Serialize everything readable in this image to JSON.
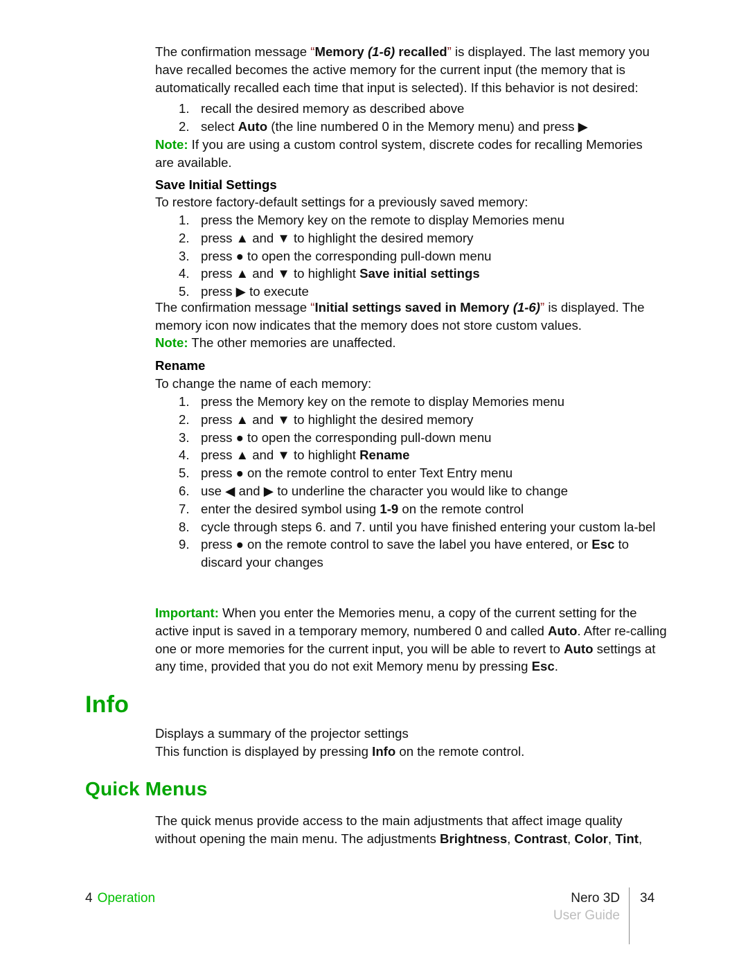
{
  "colors": {
    "accent_green": "#00a500",
    "footer_green": "#00c000",
    "quote_marks": "#8d2020",
    "body_text": "#111111",
    "muted_gray": "#bdbdbd"
  },
  "glyphs": {
    "up": "▲",
    "down": "▼",
    "dot": "●",
    "right": "▶",
    "left": "◀",
    "ldquo": "“",
    "rdquo": "”"
  },
  "blocks": {
    "para_recalled": {
      "lead": "The confirmation message ",
      "quoted_bold_1": "Memory ",
      "quoted_bolditalic": "(1-6)",
      "quoted_bold_2": " recalled",
      "tail": " is displayed. The last memory you have recalled becomes the active memory for the current input (the memory that is automatically recalled each time that input is selected). If this behavior is not desired:"
    },
    "list_recall": [
      {
        "num": "1.",
        "text": "recall the desired memory as described above"
      },
      {
        "num": "2.",
        "pre": "select ",
        "bold": "Auto",
        "post": " (the line numbered 0 in the Memory menu) and press ▶"
      }
    ],
    "note_custom_control": {
      "label": "Note:",
      "text": " If you are using a custom control system, discrete codes for recalling Memories are available."
    },
    "heading_save_initial": "Save Initial Settings",
    "para_restore": "To restore factory-default settings for a previously saved memory:",
    "list_save": [
      {
        "num": "1.",
        "text": "press the Memory key on the remote to display Memories menu"
      },
      {
        "num": "2.",
        "text": "press ▲ and ▼ to highlight the desired memory"
      },
      {
        "num": "3.",
        "text": "press ● to open the corresponding pull-down menu"
      },
      {
        "num": "4.",
        "pre": "press ▲ and ▼ to highlight ",
        "bold": "Save initial settings",
        "post": ""
      },
      {
        "num": "5.",
        "text": "press ▶ to execute"
      }
    ],
    "para_initial_saved": {
      "lead": "The confirmation message ",
      "quoted_bold_1": "Initial settings saved in Memory ",
      "quoted_bolditalic": "(1-6)",
      "quoted_bold_2": "",
      "tail": " is displayed. The memory icon now indicates that the memory does not store custom values."
    },
    "note_other_memories": {
      "label": "Note:",
      "text": " The other memories are unaffected."
    },
    "heading_rename": "Rename",
    "para_change_name": "To change the name of each memory:",
    "list_rename": [
      {
        "num": "1.",
        "text": "press the Memory key on the remote to display Memories menu"
      },
      {
        "num": "2.",
        "text": "press ▲ and ▼ to highlight the desired memory"
      },
      {
        "num": "3.",
        "text": "press ● to open the corresponding pull-down menu"
      },
      {
        "num": "4.",
        "pre": "press ▲ and ▼ to highlight ",
        "bold": "Rename",
        "post": ""
      },
      {
        "num": "5.",
        "text": "press ● on the remote control to enter Text Entry menu"
      },
      {
        "num": "6.",
        "text": "use ◀ and ▶ to underline the character you would like to change"
      },
      {
        "num": "7.",
        "pre": "enter the desired symbol using ",
        "bold": "1-9",
        "post": " on the remote control"
      },
      {
        "num": "8.",
        "text": "cycle through steps 6. and 7. until you have finished entering your custom la-bel"
      },
      {
        "num": "9.",
        "pre": "press ● on the remote control to save the label you have entered, or ",
        "bold": "Esc",
        "post": " to discard your changes"
      }
    ],
    "important_memories": {
      "label": "Important:",
      "t1": " When you enter the Memories menu, a copy of the current setting for the active input is saved in a temporary memory, numbered 0 and called ",
      "b1": "Auto",
      "t2": ". After re-calling one or more memories for the current input, you will be able to revert to ",
      "b2": "Auto",
      "t3": " settings at any time, provided that you do not exit Memory menu by pressing ",
      "b3": "Esc",
      "t4": "."
    },
    "heading_info": "Info",
    "para_info_1": "Displays a summary of the projector settings",
    "para_info_2": {
      "pre": "This function is displayed by pressing ",
      "bold": "Info",
      "post": " on the remote control."
    },
    "heading_quick_menus": "Quick Menus",
    "para_quick": {
      "pre": "The quick menus provide access to the main adjustments that affect image quality without opening the main menu. The adjustments ",
      "b1": "Brightness",
      "sep1": ", ",
      "b2": "Contrast",
      "sep2": ", ",
      "b3": "Color",
      "sep3": ", ",
      "b4": "Tint",
      "post": ","
    }
  },
  "footer": {
    "chapter_number": "4",
    "chapter_name": "Operation",
    "product": "Nero 3D",
    "guide": "User Guide",
    "page_number": "34"
  }
}
